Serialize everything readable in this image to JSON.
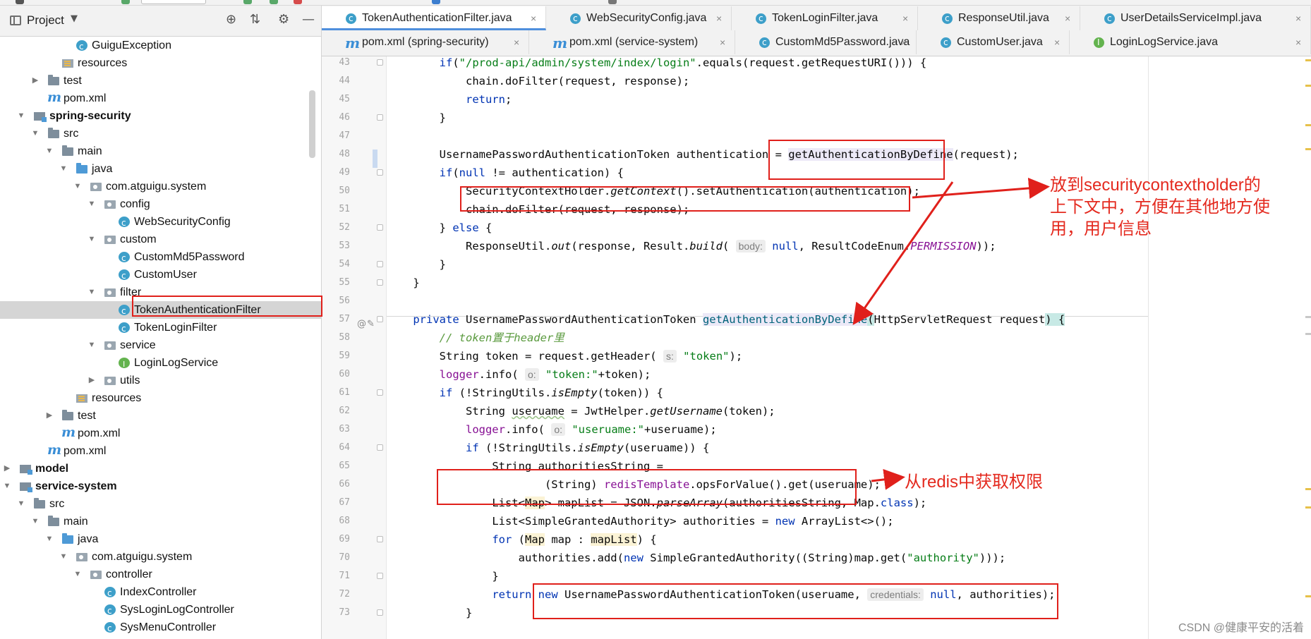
{
  "project_panel": {
    "title": "Project",
    "caret": "▼",
    "tools": {
      "locate": "⊕",
      "collapse": "⇅",
      "settings": "⚙",
      "hide": "—"
    },
    "tree": [
      {
        "label": "GuiguException",
        "icon": "class",
        "indent": 4
      },
      {
        "label": "resources",
        "icon": "resources",
        "indent": 3
      },
      {
        "label": "test",
        "icon": "folder",
        "indent": 2,
        "arrow": "▶"
      },
      {
        "label": "pom.xml",
        "icon": "maven",
        "indent": 2
      },
      {
        "label": "spring-security",
        "icon": "module",
        "indent": 1,
        "arrow": "▼",
        "bold": true
      },
      {
        "label": "src",
        "icon": "folder",
        "indent": 2,
        "arrow": "▼"
      },
      {
        "label": "main",
        "icon": "folder",
        "indent": 3,
        "arrow": "▼"
      },
      {
        "label": "java",
        "icon": "folder-blue",
        "indent": 4,
        "arrow": "▼"
      },
      {
        "label": "com.atguigu.system",
        "icon": "package",
        "indent": 5,
        "arrow": "▼"
      },
      {
        "label": "config",
        "icon": "package",
        "indent": 6,
        "arrow": "▼"
      },
      {
        "label": "WebSecurityConfig",
        "icon": "class",
        "indent": 7
      },
      {
        "label": "custom",
        "icon": "package",
        "indent": 6,
        "arrow": "▼"
      },
      {
        "label": "CustomMd5Password",
        "icon": "class",
        "indent": 7
      },
      {
        "label": "CustomUser",
        "icon": "class",
        "indent": 7
      },
      {
        "label": "filter",
        "icon": "package",
        "indent": 6,
        "arrow": "▼"
      },
      {
        "label": "TokenAuthenticationFilter",
        "icon": "class",
        "indent": 7,
        "selected": true
      },
      {
        "label": "TokenLoginFilter",
        "icon": "class",
        "indent": 7
      },
      {
        "label": "service",
        "icon": "package",
        "indent": 6,
        "arrow": "▼"
      },
      {
        "label": "LoginLogService",
        "icon": "iface",
        "indent": 7
      },
      {
        "label": "utils",
        "icon": "package",
        "indent": 6,
        "arrow": "▶"
      },
      {
        "label": "resources",
        "icon": "resources",
        "indent": 4
      },
      {
        "label": "test",
        "icon": "folder",
        "indent": 3,
        "arrow": "▶"
      },
      {
        "label": "pom.xml",
        "icon": "maven",
        "indent": 3
      },
      {
        "label": "pom.xml",
        "icon": "maven",
        "indent": 2
      },
      {
        "label": "model",
        "icon": "module",
        "indent": 0,
        "arrow": "▶",
        "bold": true
      },
      {
        "label": "service-system",
        "icon": "module",
        "indent": 0,
        "arrow": "▼",
        "bold": true
      },
      {
        "label": "src",
        "icon": "folder",
        "indent": 1,
        "arrow": "▼"
      },
      {
        "label": "main",
        "icon": "folder",
        "indent": 2,
        "arrow": "▼"
      },
      {
        "label": "java",
        "icon": "folder-blue",
        "indent": 3,
        "arrow": "▼"
      },
      {
        "label": "com.atguigu.system",
        "icon": "package",
        "indent": 4,
        "arrow": "▼"
      },
      {
        "label": "controller",
        "icon": "package",
        "indent": 5,
        "arrow": "▼"
      },
      {
        "label": "IndexController",
        "icon": "class",
        "indent": 6
      },
      {
        "label": "SysLoginLogController",
        "icon": "class",
        "indent": 6
      },
      {
        "label": "SysMenuController",
        "icon": "class",
        "indent": 6
      }
    ]
  },
  "tabs": {
    "row1": [
      {
        "label": "TokenAuthenticationFilter.java",
        "icon": "class",
        "active": true
      },
      {
        "label": "WebSecurityConfig.java",
        "icon": "class"
      },
      {
        "label": "TokenLoginFilter.java",
        "icon": "class"
      },
      {
        "label": "ResponseUtil.java",
        "icon": "class"
      },
      {
        "label": "UserDetailsServiceImpl.java",
        "icon": "class"
      }
    ],
    "row2": [
      {
        "label": "pom.xml (spring-security)",
        "icon": "maven"
      },
      {
        "label": "pom.xml (service-system)",
        "icon": "maven"
      },
      {
        "label": "CustomMd5Password.java",
        "icon": "class"
      },
      {
        "label": "CustomUser.java",
        "icon": "class"
      },
      {
        "label": "LoginLogService.java",
        "icon": "iface"
      }
    ],
    "close_glyph": "×"
  },
  "editor": {
    "line_numbers": [
      "43",
      "44",
      "45",
      "46",
      "47",
      "48",
      "49",
      "50",
      "51",
      "52",
      "53",
      "54",
      "55",
      "56",
      "57",
      "58",
      "59",
      "60",
      "61",
      "62",
      "63",
      "64",
      "65",
      "66",
      "67",
      "68",
      "69",
      "70",
      "71",
      "72",
      "73"
    ],
    "gutter_glyphs": {
      "override": "@",
      "edit": "✎"
    },
    "code": {
      "l43": {
        "if": "if",
        "open": "(",
        "uri": "\"/prod-api/admin/system/index/login\"",
        "rest": ".equals(request.getRequestURI())) {"
      },
      "l44": "chain.doFilter(request, response);",
      "l45": {
        "ret": "return",
        "semi": ";"
      },
      "l46": "}",
      "l48": {
        "decl": "UsernamePasswordAuthenticationToken authentication = ",
        "call": "getAuthenticationByDefine",
        "arg": "(request);"
      },
      "l49": {
        "if": "if",
        "open": "(",
        "null": "null",
        "rest": " != authentication) {"
      },
      "l50": {
        "cls": "SecurityContextHolder.",
        "getctx": "getContext",
        "rest": "().setAuthentication(authentication);"
      },
      "l51": "chain.doFilter(request, response);",
      "l52": {
        "close": "} ",
        "else": "else",
        "brace": " {"
      },
      "l53": {
        "a": "ResponseUtil.",
        "out": "out",
        "b": "(response, Result.",
        "build": "build",
        "c": "( ",
        "hint": "body:",
        "null": "null",
        "d": ", ResultCodeEnum.",
        "perm": "PERMISSION",
        "e": "));"
      },
      "l54": "}",
      "l55": "}",
      "l57": {
        "private": "private",
        "type": " UsernamePasswordAuthenticationToken ",
        "name": "getAuthenticationByDefine",
        "open": "(",
        "params": "HttpServletRequest request",
        "close": ") {"
      },
      "l58": {
        "comment": "// token置于header里"
      },
      "l59": {
        "a": "String token = request.getHeader( ",
        "hint": "s:",
        "str": "\"token\"",
        "b": ");"
      },
      "l60": {
        "logger": "logger",
        "a": ".info( ",
        "hint": "o:",
        "str": "\"token:\"",
        "b": "+token);"
      },
      "l61": {
        "if": "if",
        "a": " (!StringUtils.",
        "empty": "isEmpty",
        "b": "(token)) {"
      },
      "l62": {
        "a": "String ",
        "var": "useruame",
        "b": " = JwtHelper.",
        "get": "getUsername",
        "c": "(token);"
      },
      "l63": {
        "logger": "logger",
        "a": ".info( ",
        "hint": "o:",
        "str": "\"useruame:\"",
        "b": "+useruame);"
      },
      "l64": {
        "if": "if",
        "a": " (!StringUtils.",
        "empty": "isEmpty",
        "b": "(useruame)) {"
      },
      "l65": "String authoritiesString =",
      "l66": {
        "a": "(String) ",
        "redis": "redisTemplate",
        "b": ".opsForValue().get(useruame);"
      },
      "l67": {
        "a": "List<",
        "map": "Map",
        "b": "> mapList = JSON.",
        "parse": "parseArray",
        "c": "(authoritiesString, Map.",
        "cls": "class",
        "d": ");"
      },
      "l68": {
        "a": "List<SimpleGrantedAuthority> authorities = ",
        "new": "new",
        "b": " ArrayList<>();"
      },
      "l69": {
        "for": "for",
        "a": " (",
        "map": "Map",
        "b": " map : ",
        "ml": "mapList",
        "c": ") {"
      },
      "l70": {
        "a": "authorities.add(",
        "new": "new",
        "b": " SimpleGrantedAuthority((String)map.get(",
        "str": "\"authority\"",
        "c": ")));"
      },
      "l71": "}",
      "l72": {
        "ret": "return",
        "sp": " ",
        "new": "new",
        "a": " UsernamePasswordAuthenticationToken(useruame, ",
        "hint": "credentials:",
        "null": "null",
        "b": ", authorities);"
      },
      "l73": "}"
    }
  },
  "annotations": {
    "securitycontext": "放到securitycontextholder的\n上下文中，方便在其他地方使\n用，用户信息",
    "redis": "从redis中获取权限"
  },
  "watermark": "CSDN @健康平安的活着",
  "colors": {
    "annotation_red": "#e0201b",
    "keyword": "#0033b3",
    "string": "#067d17",
    "field": "#871094",
    "method_def": "#00627a",
    "active_tab": "#4f8fdd"
  }
}
